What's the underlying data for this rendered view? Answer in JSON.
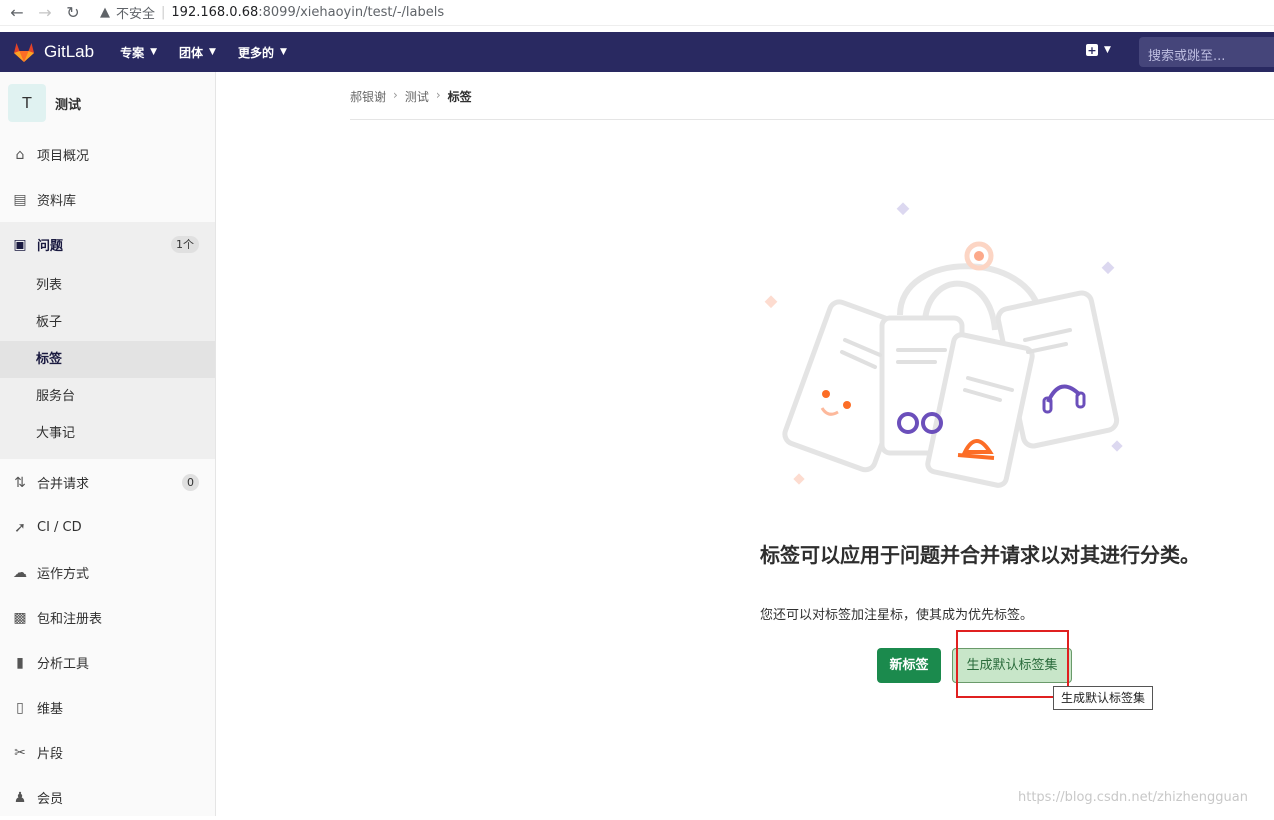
{
  "browser": {
    "insecure_label": "不安全",
    "url_host": "192.168.0.68",
    "url_path": ":8099/xiehaoyin/test/-/labels"
  },
  "topbar": {
    "logo_text": "GitLab",
    "menu": [
      "专案",
      "团体",
      "更多的"
    ],
    "search_placeholder": "搜索或跳至..."
  },
  "sidebar": {
    "project_initial": "T",
    "project_name": "测试",
    "items": [
      {
        "label": "项目概况",
        "icon": "home-icon"
      },
      {
        "label": "资料库",
        "icon": "doc-icon"
      },
      {
        "label": "问题",
        "icon": "issues-icon",
        "badge": "1个"
      },
      {
        "label": "合并请求",
        "icon": "merge-request-icon",
        "badge": "0"
      },
      {
        "label": "CI / CD",
        "icon": "rocket-icon"
      },
      {
        "label": "运作方式",
        "icon": "cloud-gear-icon"
      },
      {
        "label": "包和注册表",
        "icon": "package-icon"
      },
      {
        "label": "分析工具",
        "icon": "chart-icon"
      },
      {
        "label": "维基",
        "icon": "book-icon"
      },
      {
        "label": "片段",
        "icon": "scissors-icon"
      },
      {
        "label": "会员",
        "icon": "users-icon"
      }
    ],
    "issue_sub": [
      "列表",
      "板子",
      "标签",
      "服务台",
      "大事记"
    ]
  },
  "breadcrumb": [
    "郝银谢",
    "测试",
    "标签"
  ],
  "empty_state": {
    "title": "标签可以应用于问题并合并请求以对其进行分类。",
    "description": "您还可以对标签加注星标，使其成为优先标签。",
    "new_label_button": "新标签",
    "generate_button": "生成默认标签集",
    "tooltip": "生成默认标签集"
  },
  "watermark": "https://blog.csdn.net/zhizhengguan",
  "colors": {
    "topbar": "#292961",
    "primary_button": "#1b8a4d",
    "highlight_box": "#e02020"
  }
}
